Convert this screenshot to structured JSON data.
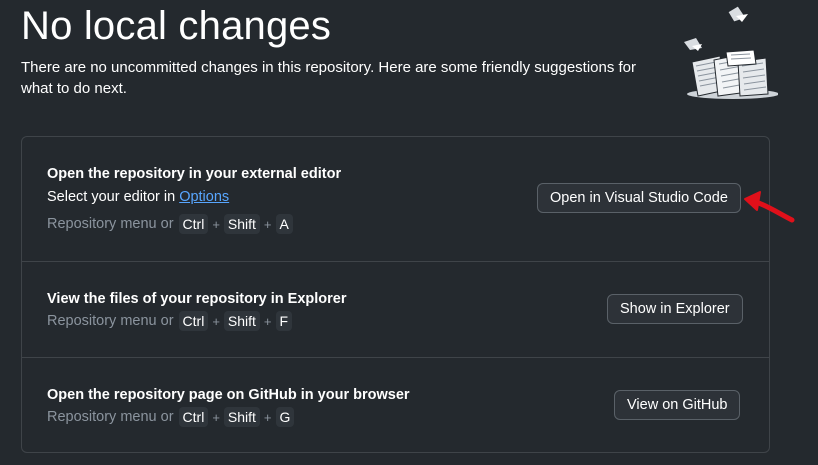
{
  "header": {
    "title": "No local changes",
    "subtitle": "There are no uncommitted changes in this repository. Here are some friendly suggestions for what to do next."
  },
  "suggestions": [
    {
      "title": "Open the repository in your external editor",
      "subtitle_prefix": "Select your editor in ",
      "subtitle_link": "Options",
      "shortcut_prefix": "Repository menu or",
      "keys": [
        "Ctrl",
        "Shift",
        "A"
      ],
      "button": "Open in Visual Studio Code"
    },
    {
      "title": "View the files of your repository in Explorer",
      "shortcut_prefix": "Repository menu or",
      "keys": [
        "Ctrl",
        "Shift",
        "F"
      ],
      "button": "Show in Explorer"
    },
    {
      "title": "Open the repository page on GitHub in your browser",
      "shortcut_prefix": "Repository menu or",
      "keys": [
        "Ctrl",
        "Shift",
        "G"
      ],
      "button": "View on GitHub"
    }
  ],
  "shortcut_separator": "+",
  "colors": {
    "background": "#24292e",
    "link": "#58a6ff",
    "muted_text": "#8b949e",
    "annotation_arrow": "#e0101a"
  },
  "icons": {
    "illustration": "paper-stack-illustration-icon",
    "annotation": "red-pointer-arrow-icon"
  }
}
